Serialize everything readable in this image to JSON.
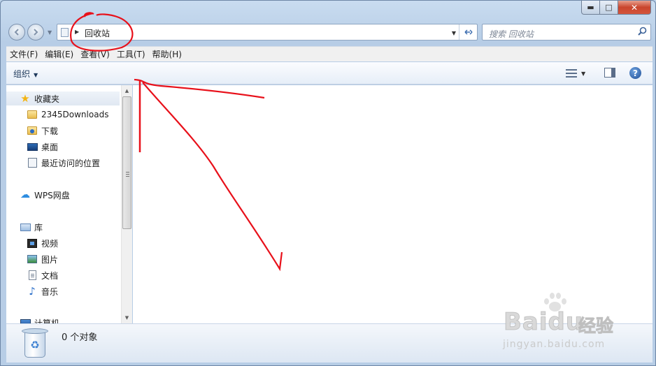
{
  "window": {
    "caption_buttons": {
      "minimize": "▬",
      "maximize": "□",
      "close": "✕"
    }
  },
  "nav": {
    "back_icon": "arrow-left-icon",
    "forward_icon": "arrow-right-icon"
  },
  "address": {
    "location": "回收站",
    "separator": "▶",
    "dropdown": "▼",
    "refresh_icon": "refresh-icon"
  },
  "search": {
    "placeholder": "搜索 回收站"
  },
  "menu": [
    "文件(F)",
    "编辑(E)",
    "查看(V)",
    "工具(T)",
    "帮助(H)"
  ],
  "toolbar": {
    "organize": "组织",
    "organize_arrow": "▼",
    "view_arrow": "▼",
    "help": "?"
  },
  "sidebar": {
    "favorites": {
      "label": "收藏夹",
      "icon": "star-icon"
    },
    "favorite_items": [
      {
        "label": "2345Downloads",
        "icon": "folder-icon"
      },
      {
        "label": "下载",
        "icon": "downloads-folder-icon"
      },
      {
        "label": "桌面",
        "icon": "desktop-icon"
      },
      {
        "label": "最近访问的位置",
        "icon": "recent-places-icon"
      }
    ],
    "wps": {
      "label": "WPS网盘",
      "icon": "cloud-icon"
    },
    "library": {
      "label": "库",
      "icon": "library-icon"
    },
    "library_items": [
      {
        "label": "视频",
        "icon": "video-icon"
      },
      {
        "label": "图片",
        "icon": "picture-icon"
      },
      {
        "label": "文档",
        "icon": "document-icon"
      },
      {
        "label": "音乐",
        "icon": "music-icon"
      }
    ],
    "computer": {
      "label": "计算机",
      "icon": "computer-icon"
    }
  },
  "status": {
    "text": "0 个对象",
    "icon": "recycle-bin-icon"
  },
  "watermark": {
    "logo": "Baidu",
    "logo_suffix": "经验",
    "url": "jingyan.baidu.com"
  },
  "colors": {
    "annotation_red": "#e8101a",
    "window_frame": "#b7cde6",
    "close_button": "#c9452d"
  }
}
